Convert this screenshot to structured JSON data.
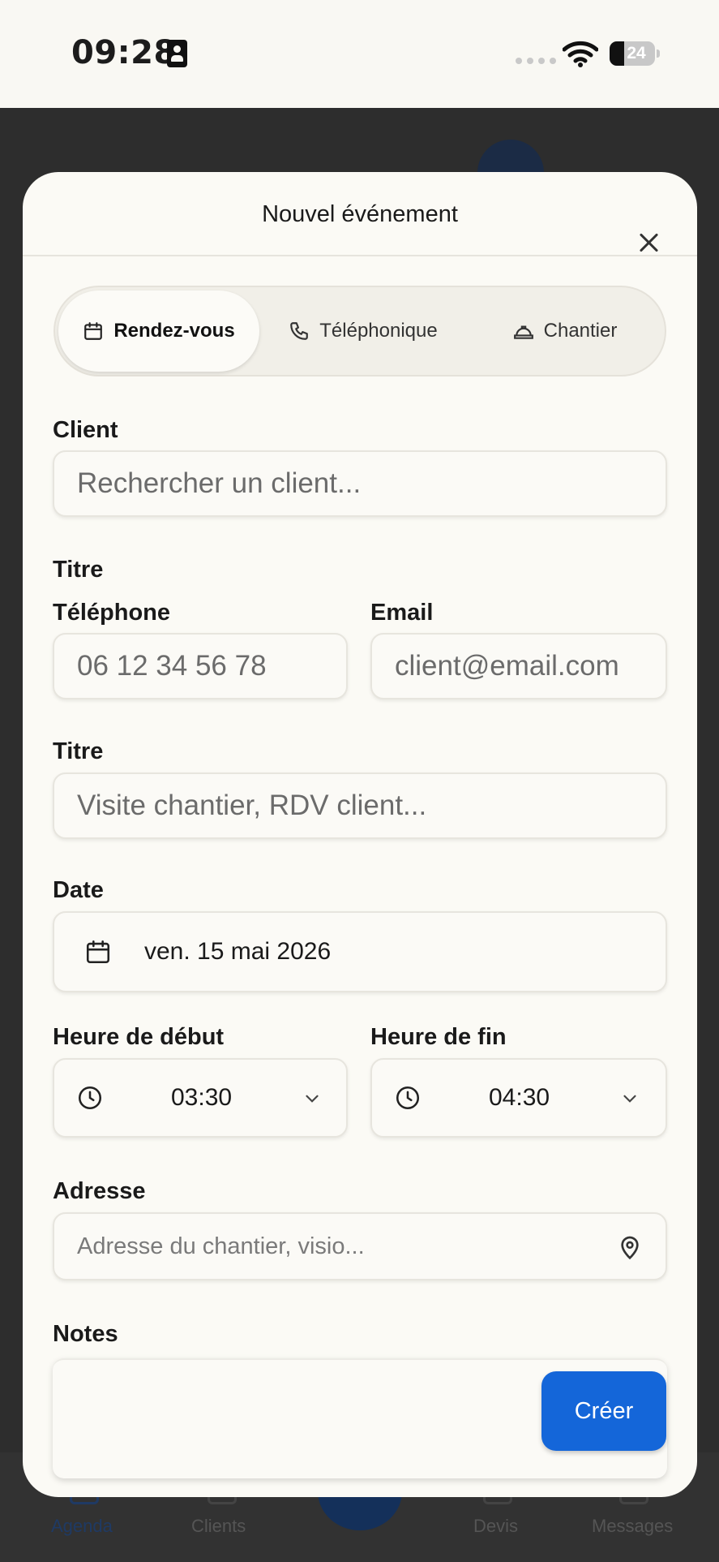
{
  "status_bar": {
    "time": "09:28",
    "battery": "24"
  },
  "bottom_nav": {
    "items": [
      "Agenda",
      "Clients",
      "Devis",
      "Messages"
    ]
  },
  "modal": {
    "title": "Nouvel événement",
    "tabs": [
      {
        "label": "Rendez-vous",
        "icon": "calendar-icon",
        "active": true
      },
      {
        "label": "Téléphonique",
        "icon": "phone-icon",
        "active": false
      },
      {
        "label": "Chantier",
        "icon": "hard-hat-icon",
        "active": false
      }
    ],
    "client": {
      "label": "Client",
      "placeholder": "Rechercher un client..."
    },
    "section_title": "Titre",
    "phone": {
      "label": "Téléphone",
      "placeholder": "06 12 34 56 78"
    },
    "email": {
      "label": "Email",
      "placeholder": "client@email.com"
    },
    "title_field": {
      "label": "Titre",
      "placeholder": "Visite chantier, RDV client..."
    },
    "date": {
      "label": "Date",
      "value": "ven. 15 mai 2026"
    },
    "start_time": {
      "label": "Heure de début",
      "value": "03:30"
    },
    "end_time": {
      "label": "Heure de fin",
      "value": "04:30"
    },
    "address": {
      "label": "Adresse",
      "placeholder": "Adresse du chantier, visio..."
    },
    "notes": {
      "label": "Notes"
    },
    "create_label": "Créer"
  },
  "colors": {
    "accent": "#1466d9",
    "background": "#fbfaf5",
    "overlay": "#2d2d2d"
  }
}
